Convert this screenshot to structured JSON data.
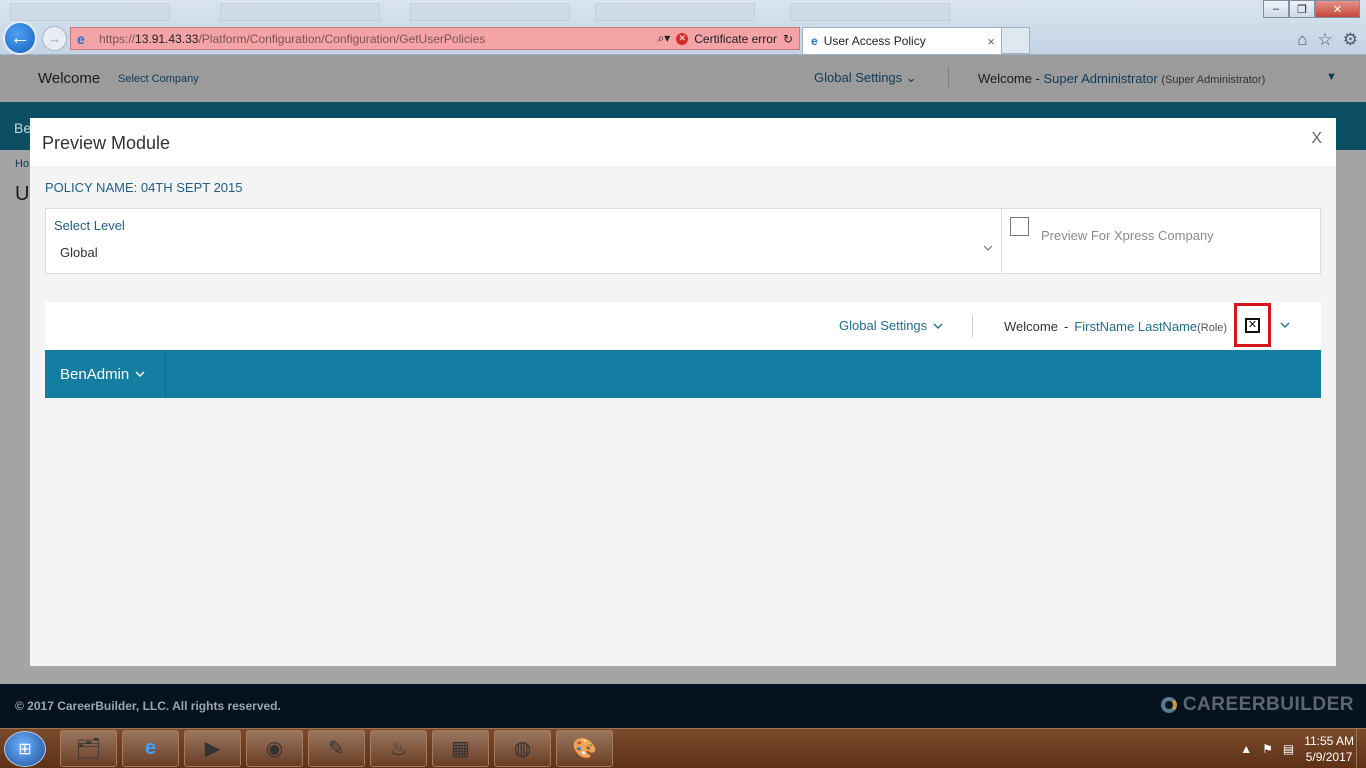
{
  "browser": {
    "url_scheme": "https://",
    "url_host": "13.91.43.33",
    "url_path": "/Platform/Configuration/Configuration/GetUserPolicies",
    "cert_error": "Certificate error",
    "tab_title": "User Access Policy",
    "tab_close": "×"
  },
  "app": {
    "welcome": "Welcome",
    "select_company": "Select Company",
    "global_settings": "Global Settings",
    "welcome_prefix": "Welcome -",
    "user_name": "Super Administrator",
    "user_role": "(Super Administrator)",
    "nav_partial": "Be",
    "breadcrumb_partial": "Ho",
    "title_partial": "U"
  },
  "modal": {
    "title": "Preview Module",
    "close_label": "X",
    "policy_name": "POLICY NAME: 04TH SEPT 2015",
    "select_level_label": "Select Level",
    "select_level_value": "Global",
    "xpress_label": "Preview For Xpress Company",
    "preview": {
      "global_settings": "Global Settings",
      "welcome": "Welcome",
      "dash": "-",
      "user_name": "FirstName LastName",
      "user_role": "(Role)",
      "nav_item": "BenAdmin"
    }
  },
  "footer": {
    "copyright": "© 2017 CareerBuilder, LLC. All rights reserved.",
    "brand": "CAREERBUILDER"
  },
  "taskbar": {
    "time": "11:55 AM",
    "date": "5/9/2017"
  },
  "colors": {
    "accent": "#147ea2",
    "link": "#1f6f8e",
    "highlight_box": "#d6141c"
  }
}
